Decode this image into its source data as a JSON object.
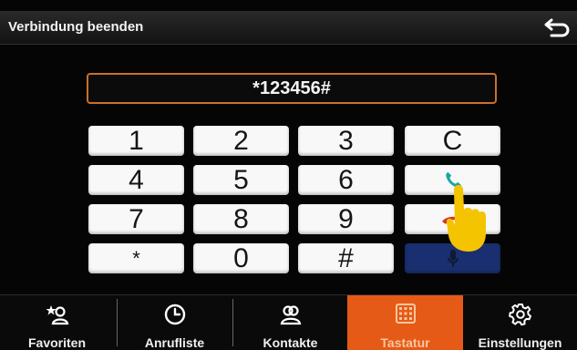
{
  "header": {
    "title": "Verbindung beenden",
    "back_icon": "back-arrow-icon"
  },
  "display": {
    "number": "*123456#"
  },
  "keypad": {
    "rows": [
      [
        "1",
        "2",
        "3",
        "C"
      ],
      [
        "4",
        "5",
        "6",
        ""
      ],
      [
        "7",
        "8",
        "9",
        ""
      ],
      [
        "*",
        "0",
        "#",
        ""
      ]
    ],
    "call_icon": "phone-call-icon",
    "hangup_icon": "phone-hangup-icon",
    "mic_icon": "microphone-icon",
    "call_color": "#1aa8a0",
    "hangup_color": "#d9362a",
    "mic_background": "#1a2f70"
  },
  "nav": {
    "items": [
      {
        "label": "Favoriten",
        "icon": "favorites-icon"
      },
      {
        "label": "Anrufliste",
        "icon": "clock-icon"
      },
      {
        "label": "Kontakte",
        "icon": "contacts-icon"
      },
      {
        "label": "Tastatur",
        "icon": "keypad-icon",
        "active": true
      },
      {
        "label": "Einstellungen",
        "icon": "gear-icon"
      }
    ],
    "active_color": "#e55a16"
  }
}
